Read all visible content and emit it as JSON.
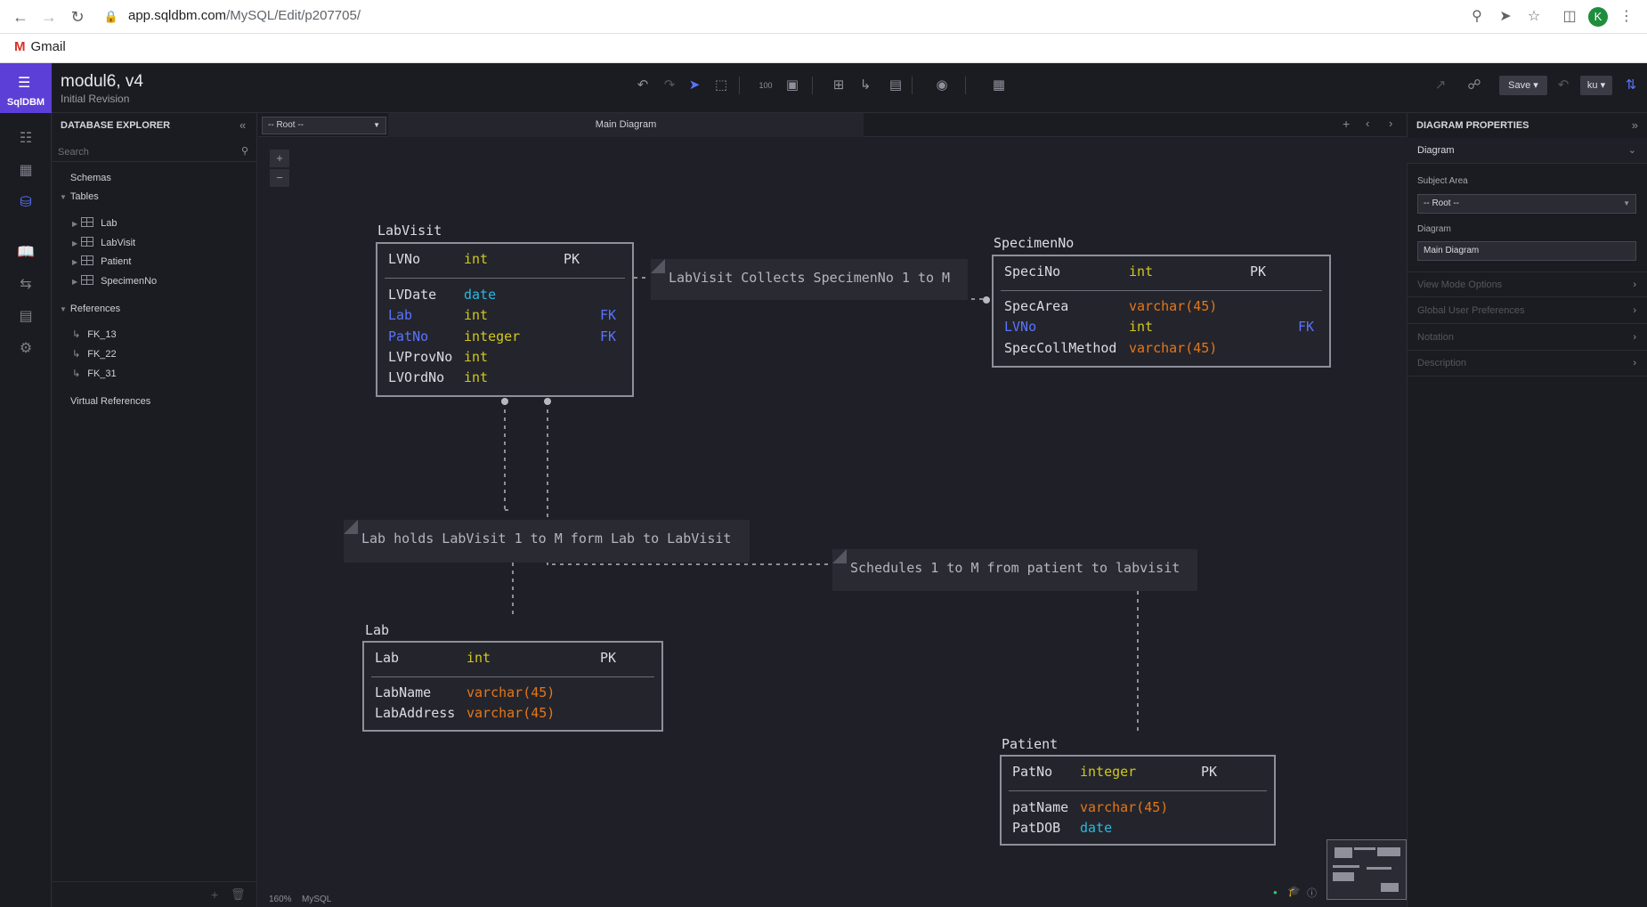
{
  "browser": {
    "url_host": "app.sqldbm.com",
    "url_path": "/MySQL/Edit/p207705/",
    "bookmark": "Gmail",
    "profile_initial": "K"
  },
  "header": {
    "logo_text": "SqlDBM",
    "project_title": "modul6, v4",
    "revision": "Initial Revision",
    "save_label": "Save",
    "user_label": "ku"
  },
  "explorer": {
    "title": "DATABASE EXPLORER",
    "search_placeholder": "Search",
    "schemas": "Schemas",
    "tables_label": "Tables",
    "tables": [
      "Lab",
      "LabVisit",
      "Patient",
      "SpecimenNo"
    ],
    "references_label": "References",
    "references": [
      "FK_13",
      "FK_22",
      "FK_31"
    ],
    "virtual_references": "Virtual References"
  },
  "canvas": {
    "root_select": "-- Root --",
    "diagram_tab": "Main Diagram",
    "zoom": "160%",
    "db": "MySQL"
  },
  "tables": {
    "labvisit": {
      "name": "LabVisit",
      "pk_row": {
        "col": "LVNo",
        "type": "int",
        "key": "PK"
      },
      "rows": [
        {
          "col": "LVDate",
          "type": "date",
          "key": ""
        },
        {
          "col": "Lab",
          "type": "int",
          "key": "FK"
        },
        {
          "col": "PatNo",
          "type": "integer",
          "key": "FK"
        },
        {
          "col": "LVProvNo",
          "type": "int",
          "key": ""
        },
        {
          "col": "LVOrdNo",
          "type": "int",
          "key": ""
        }
      ]
    },
    "specimenno": {
      "name": "SpecimenNo",
      "pk_row": {
        "col": "SpeciNo",
        "type": "int",
        "key": "PK"
      },
      "rows": [
        {
          "col": "SpecArea",
          "type": "varchar(45)",
          "key": ""
        },
        {
          "col": "LVNo",
          "type": "int",
          "key": "FK"
        },
        {
          "col": "SpecCollMethod",
          "type": "varchar(45)",
          "key": ""
        }
      ]
    },
    "lab": {
      "name": "Lab",
      "pk_row": {
        "col": "Lab",
        "type": "int",
        "key": "PK"
      },
      "rows": [
        {
          "col": "LabName",
          "type": "varchar(45)",
          "key": ""
        },
        {
          "col": "LabAddress",
          "type": "varchar(45)",
          "key": ""
        }
      ]
    },
    "patient": {
      "name": "Patient",
      "pk_row": {
        "col": "PatNo",
        "type": "integer",
        "key": "PK"
      },
      "rows": [
        {
          "col": "patName",
          "type": "varchar(45)",
          "key": ""
        },
        {
          "col": "PatDOB",
          "type": "date",
          "key": ""
        }
      ]
    }
  },
  "notes": {
    "collects": "LabVisit Collects SpecimenNo 1 to M",
    "holds": "Lab holds LabVisit 1 to M form Lab to LabVisit",
    "schedules": "Schedules 1 to M from patient to labvisit"
  },
  "properties": {
    "title": "DIAGRAM PROPERTIES",
    "section_diagram": "Diagram",
    "subject_area_label": "Subject Area",
    "subject_area_value": "-- Root --",
    "diagram_label": "Diagram",
    "diagram_value": "Main Diagram",
    "collapsed_sections": [
      "View Mode Options",
      "Global User Preferences",
      "Notation",
      "Description"
    ]
  },
  "colors": {
    "accent": "#5b3fd6",
    "type_int": "#d1c81e",
    "type_date": "#29b8e0",
    "type_varchar": "#e67617",
    "fk": "#5a73ff"
  }
}
